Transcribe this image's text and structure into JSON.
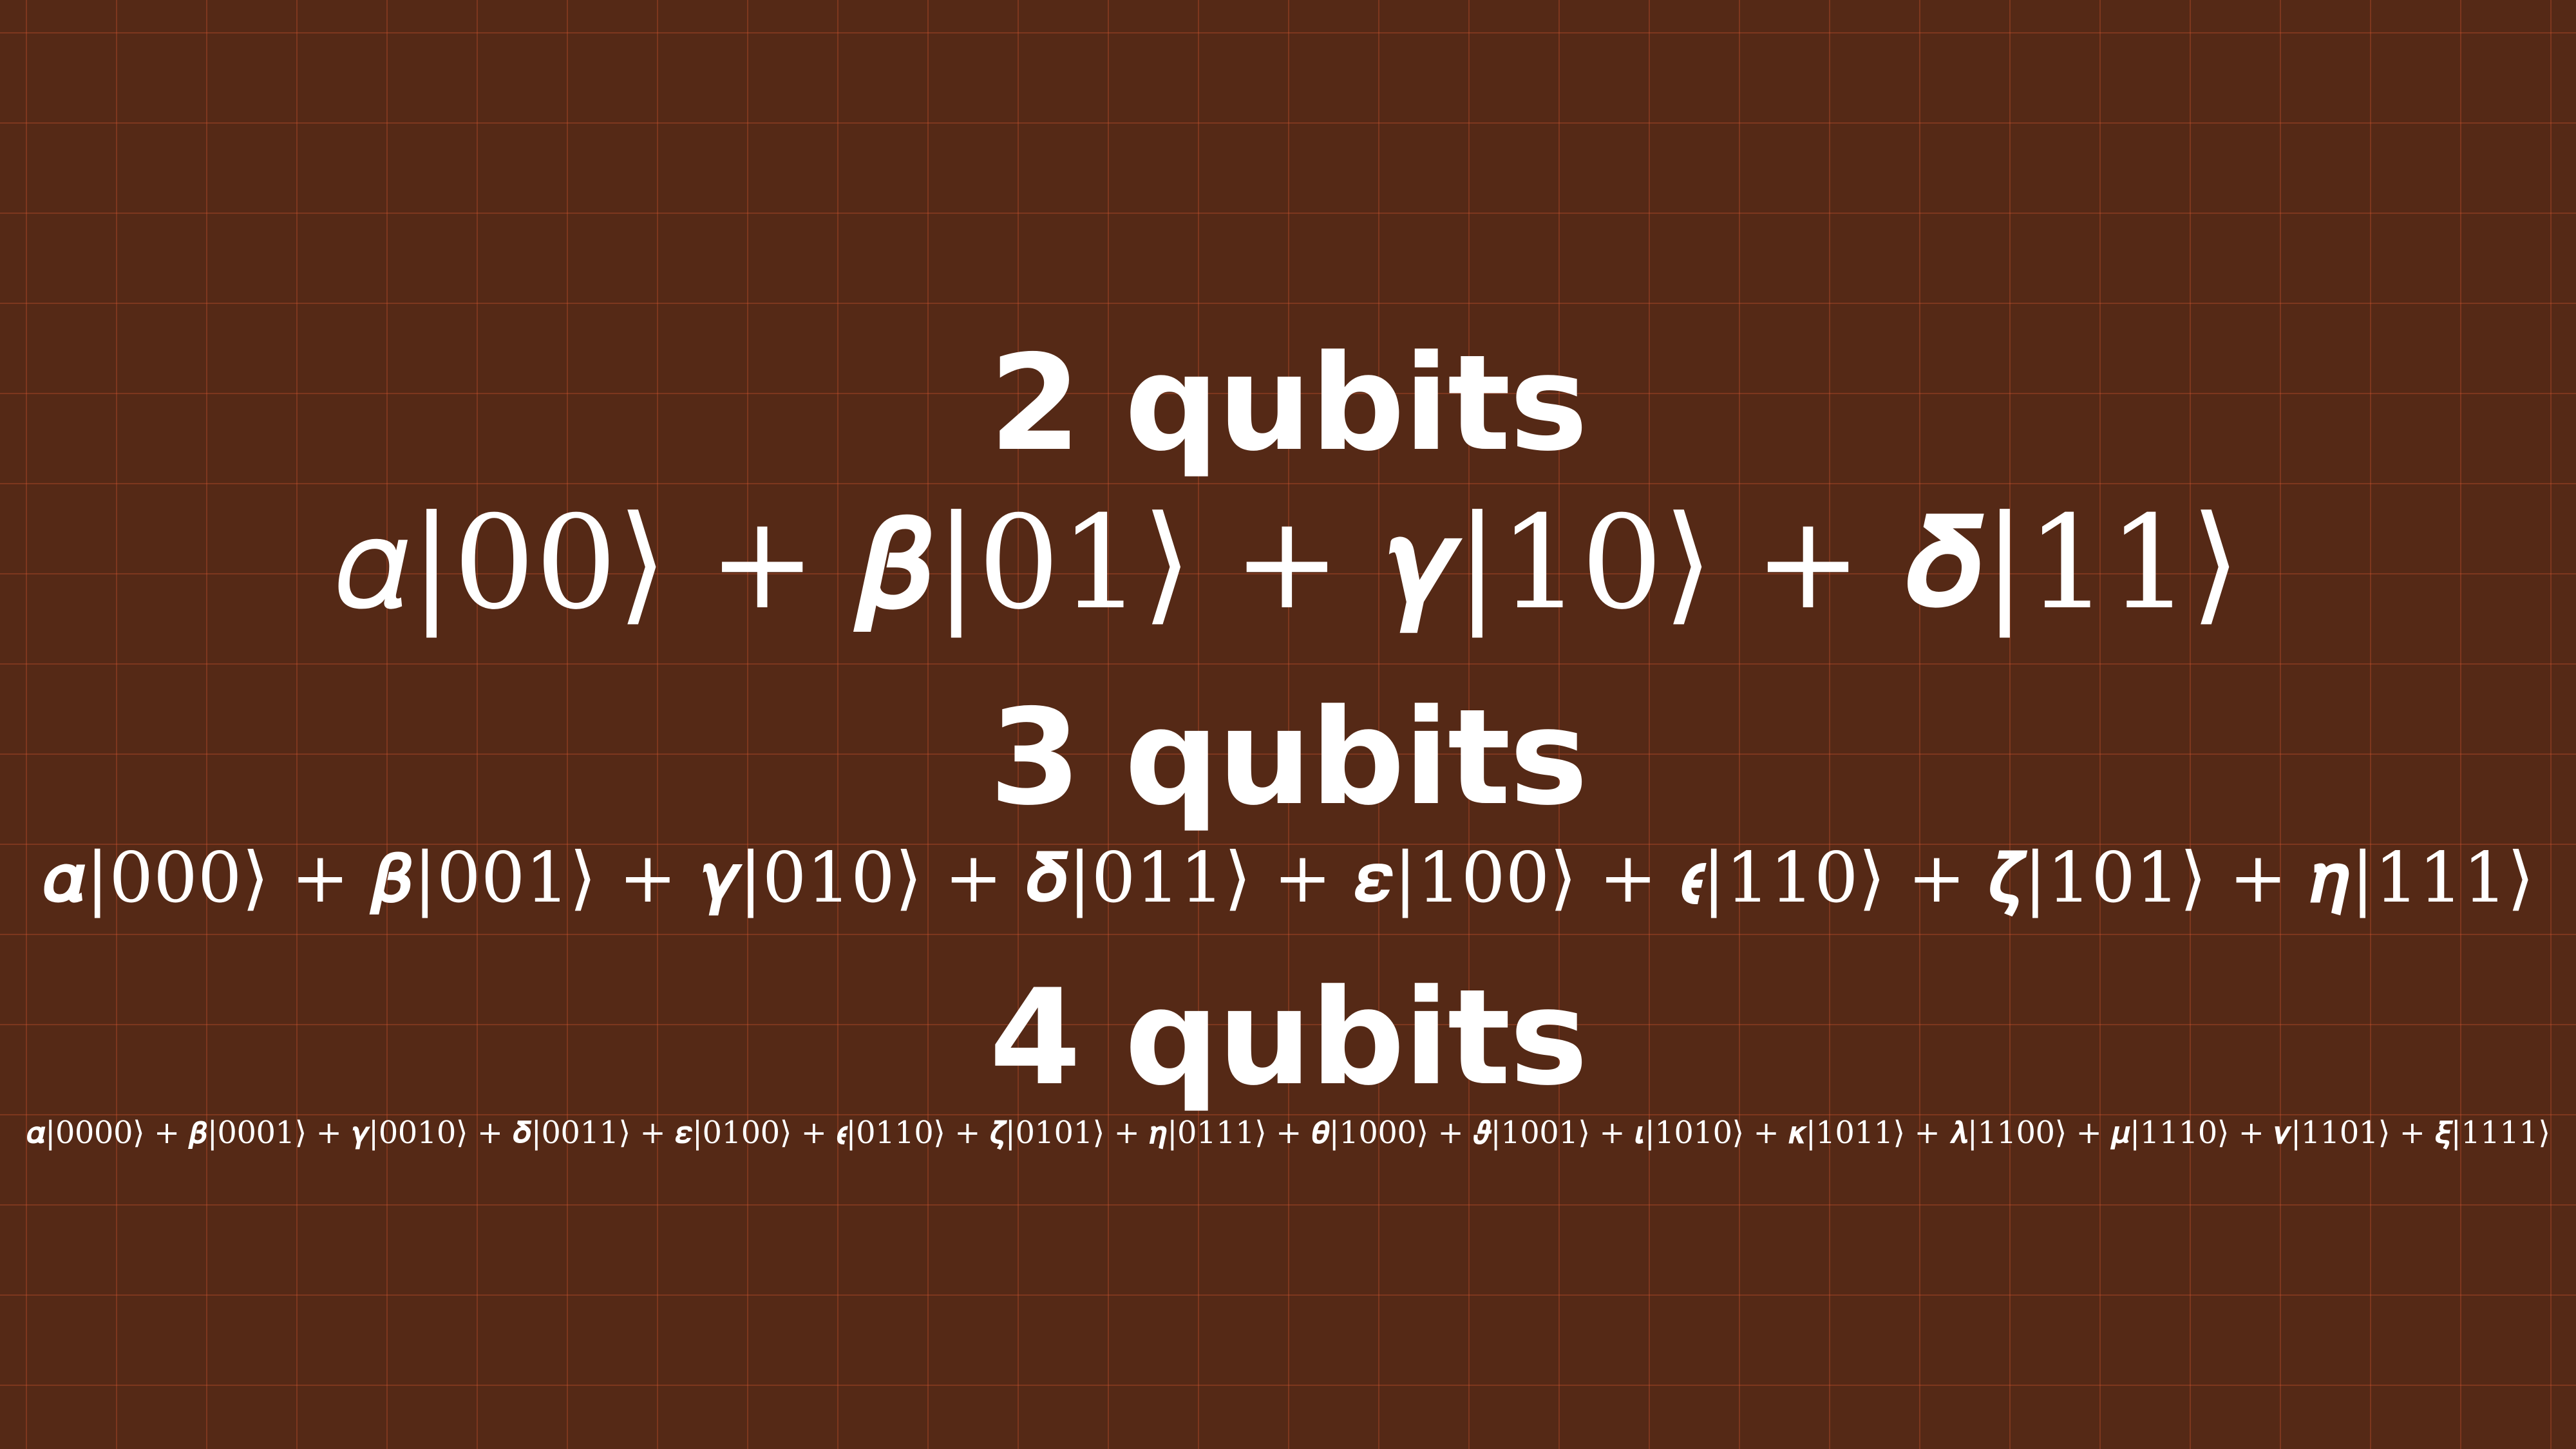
{
  "sections": [
    {
      "heading": "2 qubits",
      "equation": "𝛼|00⟩ + 𝜷|01⟩ + 𝜸|10⟩ + 𝜹|11⟩"
    },
    {
      "heading": "3 qubits",
      "equation": "𝜶|000⟩ + 𝜷|001⟩ + 𝜸|010⟩ + 𝜹|011⟩ + 𝜺|100⟩ + 𝝐|110⟩ + 𝜻|101⟩ + 𝜼|111⟩"
    },
    {
      "heading": "4 qubits",
      "equation": "𝜶|0000⟩ + 𝜷|0001⟩ + 𝜸|0010⟩ + 𝜹|0011⟩ + 𝜺|0100⟩ + 𝝐|0110⟩ + 𝜻|0101⟩ + 𝜼|0111⟩ + 𝜽|1000⟩ + 𝝑|1001⟩ + 𝜾|1010⟩ + 𝜿|1011⟩ + 𝝀|1100⟩ + 𝝁|1110⟩ + 𝝂|1101⟩ + 𝝃|1111⟩"
    }
  ],
  "colors": {
    "background": "#552916",
    "grid": "#c8552c",
    "text": "#ffffff"
  }
}
